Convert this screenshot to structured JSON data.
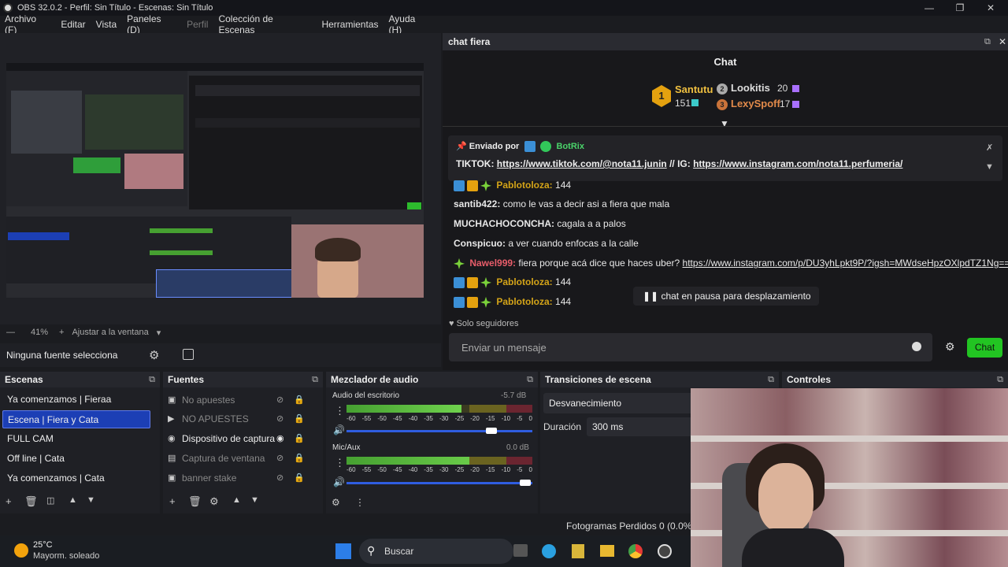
{
  "window": {
    "title": "OBS 32.0.2 - Perfil: Sin Título - Escenas: Sin Título"
  },
  "menu": [
    {
      "label": "Archivo (F)",
      "enabled": true
    },
    {
      "label": "Editar",
      "enabled": true
    },
    {
      "label": "Vista",
      "enabled": true
    },
    {
      "label": "Paneles (D)",
      "enabled": true
    },
    {
      "label": "Perfil",
      "enabled": false
    },
    {
      "label": "Colección de Escenas",
      "enabled": true
    },
    {
      "label": "Herramientas",
      "enabled": true
    },
    {
      "label": "Ayuda (H)",
      "enabled": true
    }
  ],
  "preview": {
    "zoom": "41%",
    "fit_label": "Ajustar a la ventana"
  },
  "source_toolbar": {
    "no_source": "Ninguna fuente selecciona"
  },
  "chat": {
    "dock_title": "chat fiera",
    "header": "Chat",
    "leaderboard": [
      {
        "rank": "1",
        "name": "Santutu",
        "count": "151"
      },
      {
        "rank": "2",
        "name": "Lookitis",
        "count": "20"
      },
      {
        "rank": "3",
        "name": "LexySpoff",
        "count": "17"
      }
    ],
    "pinned": {
      "sent_by_label": "Enviado por",
      "sender": "BotRix",
      "prefix": "TIKTOK:",
      "link1": "https://www.tiktok.com/@nota11.junin",
      "middle": "// IG:",
      "link2": "https://www.instagram.com/nota11.perfumeria/"
    },
    "messages": [
      {
        "user": "Pablotoloza:",
        "text": "144",
        "color": "#d4a418",
        "badges": true
      },
      {
        "user": "santib422:",
        "text": "como le vas a decir asi a fiera que mala",
        "color": "#e8e8e8",
        "badges": false
      },
      {
        "user": "MUCHACHOCONCHA:",
        "text": "cagala a a palos",
        "color": "#e8e8e8",
        "badges": false
      },
      {
        "user": "Conspicuo:",
        "text": "a ver cuando enfocas a la calle",
        "color": "#e8e8e8",
        "badges": false
      },
      {
        "user": "Nawel999:",
        "text": "fiera porque acá dice que haces uber?",
        "link": "https://www.instagram.com/p/DU3yhLpkt9P/?igsh=MWdseHpzOXlpdTZ1Ng==",
        "color": "#e85d6a",
        "badges": true
      },
      {
        "user": "Pablotoloza:",
        "text": "144",
        "color": "#d4a418",
        "badges": true
      },
      {
        "user": "Pablotoloza:",
        "text": "144",
        "color": "#d4a418",
        "badges": true
      }
    ],
    "paused_label": "chat en pausa para desplazamiento",
    "followers_only": "Solo seguidores",
    "input_placeholder": "Enviar un mensaje",
    "send_button": "Chat"
  },
  "docks": {
    "scenes": {
      "title": "Escenas",
      "items": [
        {
          "label": "Ya comenzamos | Fieraa",
          "selected": false
        },
        {
          "label": "Escena | Fiera y Cata",
          "selected": true
        },
        {
          "label": "FULL CAM",
          "selected": false
        },
        {
          "label": "Off line | Cata",
          "selected": false
        },
        {
          "label": "Ya comenzamos | Cata",
          "selected": false
        }
      ]
    },
    "sources": {
      "title": "Fuentes",
      "items": [
        {
          "label": "No apuestes",
          "visible": false,
          "icon": "image-icon"
        },
        {
          "label": "NO APUESTES",
          "visible": false,
          "icon": "media-icon"
        },
        {
          "label": "Dispositivo de captura",
          "visible": true,
          "icon": "camera-icon"
        },
        {
          "label": "Captura de ventana",
          "visible": false,
          "icon": "window-icon"
        },
        {
          "label": "banner stake",
          "visible": false,
          "icon": "image-icon"
        }
      ]
    },
    "mixer": {
      "title": "Mezclador de audio",
      "channels": [
        {
          "name": "Audio del escritorio",
          "db": "-5.7 dB",
          "level": 0.62,
          "volume": 0.78
        },
        {
          "name": "Mic/Aux",
          "db": "0.0 dB",
          "level": 0.78,
          "volume": 0.96
        }
      ],
      "scale": [
        "-60",
        "-55",
        "-50",
        "-45",
        "-40",
        "-35",
        "-30",
        "-25",
        "-20",
        "-15",
        "-10",
        "-5",
        "0"
      ]
    },
    "transitions": {
      "title": "Transiciones de escena",
      "type": "Desvanecimiento",
      "duration_label": "Duración",
      "duration_value": "300 ms"
    },
    "controls": {
      "title": "Controles"
    }
  },
  "statusbar": {
    "dropped_frames": "Fotogramas Perdidos 0 (0.0%)"
  },
  "taskbar": {
    "temp": "25°C",
    "weather": "Mayorm. soleado",
    "search": "Buscar"
  }
}
